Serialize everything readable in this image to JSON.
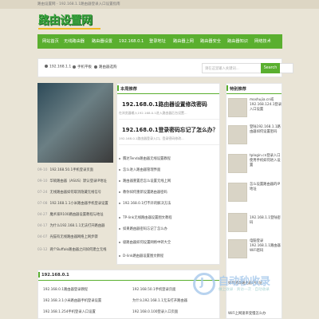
{
  "header": {
    "breadcrumb": "路由设置网 - 192.168.1.1路由器登录入口设置指南",
    "logo_text": "路由设置网"
  },
  "nav": [
    "网站首页",
    "无线路由器",
    "路由器设置",
    "192.168.0.1",
    "登录地址",
    "路由器上网",
    "路由器安全",
    "路由器知识",
    "网络技术"
  ],
  "search": {
    "items": [
      "192.168.1.1",
      "手机平板",
      "路由器选购"
    ],
    "placeholder": "请在这里输入关键词...",
    "button": "Search"
  },
  "hot": {
    "title": "本周推荐",
    "items": [
      {
        "title": "192.168.0.1路由器设置修改密码",
        "desc": "在浏览器输入192.168.0.1进入路由器后台设置..."
      },
      {
        "title": "192.168.0.1登录密码忘记了怎么办？",
        "desc": "192.168.0.1路由器登录入口，登录密码修改..."
      }
    ],
    "list": [
      "腾达Tenda路由器无线设置教程",
      "怎么进入路由器管理界面",
      "路由器重置后怎么设置无线上网",
      "教你如何重新设置路由器密码",
      "192.168.0.1打不开的解决方法",
      "TP-link无线路由器设置图文教程",
      "如果路由器密码忘记了怎么办",
      "极路由器如何设置网络中转大全",
      "D-link路由器设置图文教程"
    ]
  },
  "left_list": [
    {
      "date": "09-10",
      "text": "192.168.50.1手机登录页面"
    },
    {
      "date": "09-10",
      "text": "华硕路由器（ASUS）默认登录IP地址"
    },
    {
      "date": "07-24",
      "text": "无线路由器如何取消隐藏无线信号"
    },
    {
      "date": "07-08",
      "text": "192.168.1.1小米路由器手机登录设置"
    },
    {
      "date": "04-27",
      "text": "魔术家R100路由器设置教程与地址"
    },
    {
      "date": "04-17",
      "text": "为什么192.168.1.1无法打开路由器"
    },
    {
      "date": "04-07",
      "text": "光猫有无线路由器网络上网步骤"
    },
    {
      "date": "03-12",
      "text": "两个Buffalo路由器之间如何建立无线"
    }
  ],
  "right": {
    "title": "特别推荐",
    "items": [
      "moshujia.cn或192.168.124.1登录入口设置",
      "登陆192.168.1.1路由器如何设置密码",
      "tplogin.cn登录入口使用手机如何进入设置",
      "怎么设置路由器的IP地址",
      "192.168.1.1登陆密码",
      "电脑登录192.168.1.1路由器WiFi密码",
      "如何修改路由器IP地址",
      "WiFi上网速率变慢怎么办"
    ]
  },
  "bottom": {
    "title": "192.168.0.1",
    "items": [
      "192.168.0.1路由器登录教程",
      "192.168.50.1手机登录页面",
      "192.168.3.1小米路由器手机登录设置",
      "为什么192.168.1.1无法打开路由器",
      "192.168.1.254手机登录入口设置",
      "192.168.0.100登录入口页面"
    ]
  },
  "watermark": {
    "text": "自动秒收录",
    "sub": "做上收录 · 真访一次 · 自动收录"
  }
}
